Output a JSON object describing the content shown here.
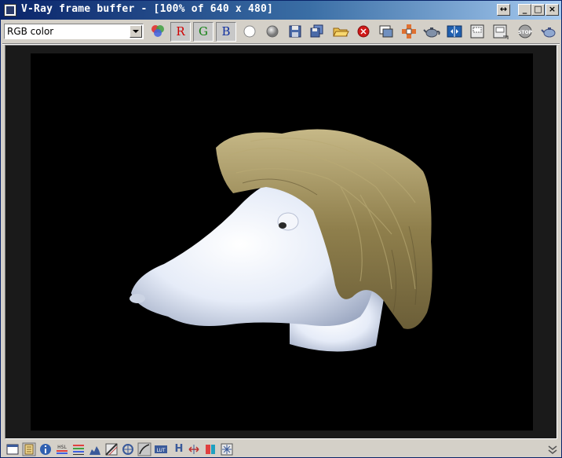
{
  "window": {
    "title": "V-Ray frame buffer - [100% of 640 x 480]"
  },
  "toolbar": {
    "channel_select": {
      "value": "RGB color"
    },
    "channel_buttons": {
      "r": "R",
      "g": "G",
      "b": "B"
    }
  },
  "statusbar": {
    "h_label": "H"
  },
  "colors": {
    "titlebar_start": "#0a246a",
    "titlebar_end": "#a6caf0",
    "render_background": "#000000",
    "hair": "#9a8a55",
    "head": "#e8eefa",
    "clear_button": "#d01818"
  }
}
